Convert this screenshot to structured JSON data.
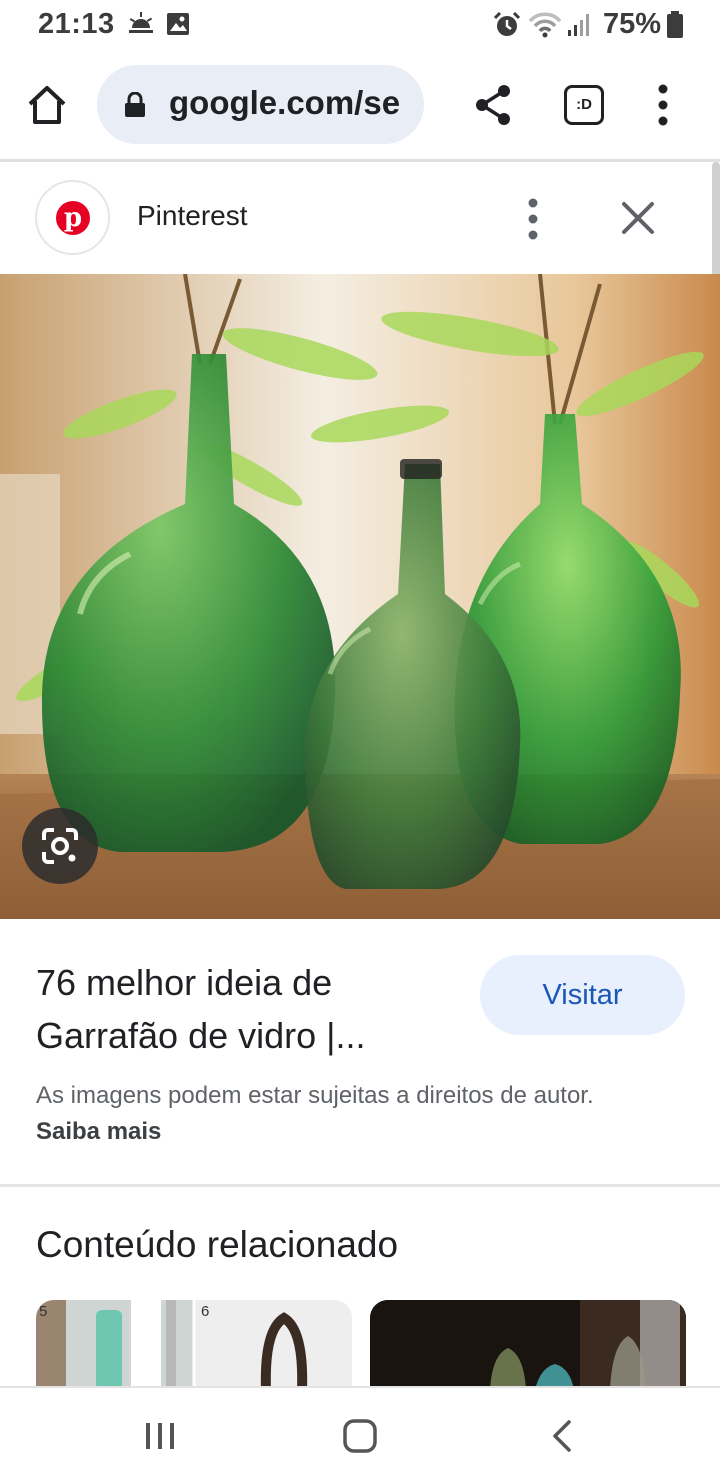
{
  "status_bar": {
    "time": "21:13",
    "battery": "75%",
    "icons": [
      "sunrise-icon",
      "gallery-icon",
      "alarm-icon",
      "wifi-icon",
      "signal-icon",
      "battery-icon"
    ]
  },
  "browser": {
    "url": "google.com/se",
    "buttons": [
      "home-icon",
      "share-icon",
      "tab-switcher-icon",
      "overflow-menu-icon"
    ],
    "tab_label": ":D"
  },
  "source": {
    "name": "Pinterest",
    "logo": "pinterest-logo",
    "logo_letter": "p"
  },
  "result": {
    "title": "76 melhor ideia de Garrafão de vidro |...",
    "visit_label": "Visitar",
    "copyright_text": "As imagens podem estar sujeitas a direitos de autor.",
    "learn_more": "Saiba mais"
  },
  "related": {
    "title": "Conteúdo relacionado",
    "thumb_labels": [
      "5",
      "6"
    ]
  },
  "colors": {
    "visit_bg": "#e8f0fe",
    "visit_text": "#1a56b8",
    "url_pill": "#e9eef6",
    "pinterest_red": "#e60023"
  }
}
